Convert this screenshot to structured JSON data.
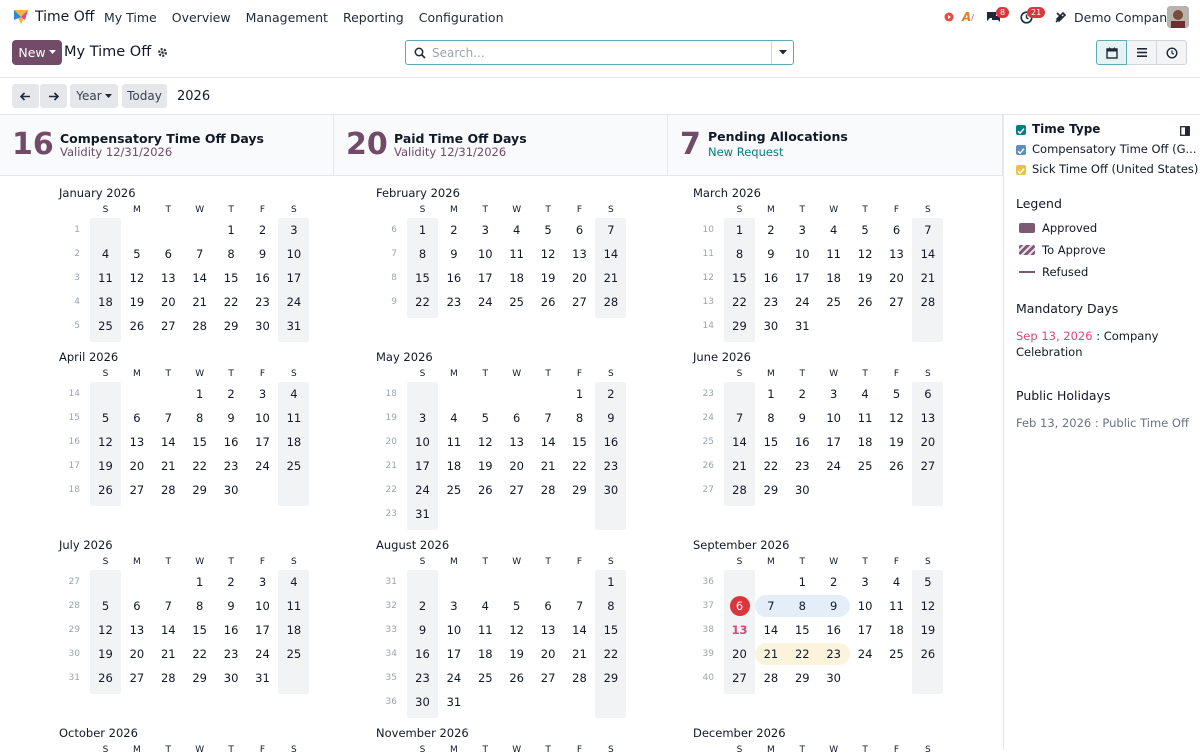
{
  "navbar": {
    "app_name": "Time Off",
    "menu": [
      "My Time",
      "Overview",
      "Management",
      "Reporting",
      "Configuration"
    ],
    "messages_badge": "8",
    "activities_badge": "21",
    "company": "Demo Company"
  },
  "control_panel": {
    "new_label": "New",
    "breadcrumb": "My Time Off",
    "search_placeholder": "Search..."
  },
  "period": {
    "year_label": "Year",
    "today_label": "Today",
    "current": "2026"
  },
  "cards": [
    {
      "number": "16",
      "title": "Compensatory Time Off Days",
      "subtitle": "Validity 12/31/2026"
    },
    {
      "number": "20",
      "title": "Paid Time Off Days",
      "subtitle": "Validity 12/31/2026"
    },
    {
      "number": "7",
      "title": "Pending Allocations",
      "subtitle": "New Request"
    }
  ],
  "side_panel": {
    "time_type_heading": "Time Type",
    "time_types": [
      "Compensatory Time Off (G...",
      "Sick Time Off (United States)"
    ],
    "colors": {
      "time_type_all": "#017e84",
      "compensatory": "#5b8fbd",
      "sick": "#e9c441",
      "brand": "#714b67"
    },
    "legend_heading": "Legend",
    "legend": [
      "Approved",
      "To Approve",
      "Refused"
    ],
    "mandatory_heading": "Mandatory Days",
    "mandatory_date": "Sep 13, 2026",
    "mandatory_name": ": Company Celebration",
    "public_heading": "Public Holidays",
    "public_holiday": "Feb 13, 2026 : Public Time Off"
  },
  "calendar": {
    "weekday_letters": [
      "S",
      "M",
      "T",
      "W",
      "T",
      "F",
      "S"
    ],
    "months": [
      {
        "name": "January 2026",
        "first_dow": 4,
        "days": 31,
        "weeks": [
          "1",
          "2",
          "3",
          "4",
          "5"
        ]
      },
      {
        "name": "February 2026",
        "first_dow": 0,
        "days": 28,
        "weeks": [
          "6",
          "7",
          "8",
          "9"
        ]
      },
      {
        "name": "March 2026",
        "first_dow": 0,
        "days": 31,
        "weeks": [
          "10",
          "11",
          "12",
          "13",
          "14"
        ]
      },
      {
        "name": "April 2026",
        "first_dow": 3,
        "days": 30,
        "weeks": [
          "14",
          "15",
          "16",
          "17",
          "18"
        ]
      },
      {
        "name": "May 2026",
        "first_dow": 5,
        "days": 31,
        "weeks": [
          "18",
          "19",
          "20",
          "21",
          "22",
          "23"
        ]
      },
      {
        "name": "June 2026",
        "first_dow": 1,
        "days": 30,
        "weeks": [
          "23",
          "24",
          "25",
          "26",
          "27"
        ]
      },
      {
        "name": "July 2026",
        "first_dow": 3,
        "days": 31,
        "weeks": [
          "27",
          "28",
          "29",
          "30",
          "31"
        ]
      },
      {
        "name": "August 2026",
        "first_dow": 6,
        "days": 31,
        "weeks": [
          "31",
          "32",
          "33",
          "34",
          "35",
          "36"
        ]
      },
      {
        "name": "September 2026",
        "first_dow": 2,
        "days": 30,
        "weeks": [
          "36",
          "37",
          "38",
          "39",
          "40"
        ]
      },
      {
        "name": "October 2026",
        "first_dow": 4,
        "days": 31,
        "weeks": []
      },
      {
        "name": "November 2026",
        "first_dow": 0,
        "days": 30,
        "weeks": []
      },
      {
        "name": "December 2026",
        "first_dow": 2,
        "days": 31,
        "weeks": []
      }
    ],
    "today": {
      "month_index": 8,
      "day": 6
    },
    "mandatory_day": {
      "month_index": 8,
      "day": 13
    },
    "public_holiday": {
      "month_index": 1,
      "day": 13
    },
    "approved_leave": {
      "month_index": 8,
      "from": 7,
      "to": 9
    },
    "to_approve_leave": {
      "month_index": 8,
      "from": 21,
      "to": 23
    }
  }
}
